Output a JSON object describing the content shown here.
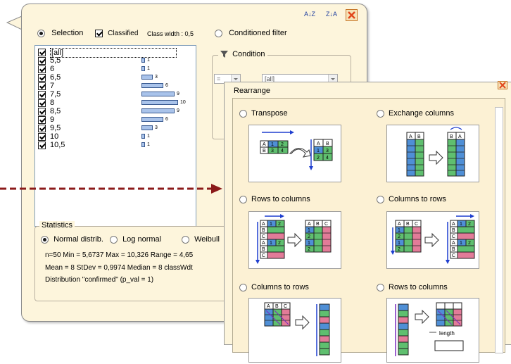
{
  "filter_panel": {
    "sort_asc_label": "A↓Z",
    "sort_desc_label": "Z↓A",
    "selection_label": "Selection",
    "classified_label": "Classified",
    "class_width_label": "Class width : 0,5",
    "conditioned_filter_label": "Conditioned filter",
    "condition_label": "Condition",
    "operator_value": "=",
    "condition_value": "[all]",
    "list_items": [
      {
        "label": "[all]",
        "count": null,
        "fraction": 0
      },
      {
        "label": "5,5",
        "count": "1",
        "fraction": 0.1
      },
      {
        "label": "6",
        "count": "1",
        "fraction": 0.1
      },
      {
        "label": "6,5",
        "count": "3",
        "fraction": 0.3
      },
      {
        "label": "7",
        "count": "6",
        "fraction": 0.6
      },
      {
        "label": "7,5",
        "count": "9",
        "fraction": 0.9
      },
      {
        "label": "8",
        "count": "10",
        "fraction": 1.0
      },
      {
        "label": "8,5",
        "count": "9",
        "fraction": 0.9
      },
      {
        "label": "9",
        "count": "6",
        "fraction": 0.6
      },
      {
        "label": "9,5",
        "count": "3",
        "fraction": 0.3
      },
      {
        "label": "10",
        "count": "1",
        "fraction": 0.1
      },
      {
        "label": "10,5",
        "count": "1",
        "fraction": 0.1
      }
    ],
    "statistics": {
      "title": "Statistics",
      "normal_label": "Normal distrib.",
      "lognormal_label": "Log normal",
      "weibull_label": "Weibull",
      "line1": "n=50   Min = 5,6737   Max = 10,326   Range = 4,65",
      "line2": "Mean = 8   StDev = 0,9974   Median = 8   classWdt",
      "line3": "Distribution \"confirmed\" (p_val = 1)"
    }
  },
  "rearrange": {
    "title": "Rearrange",
    "options": [
      {
        "label": "Transpose"
      },
      {
        "label": "Exchange columns"
      },
      {
        "label": "Rows to columns"
      },
      {
        "label": "Columns to rows"
      },
      {
        "label": "Columns to rows"
      },
      {
        "label": "Rows to columns"
      }
    ],
    "length_label": "length"
  },
  "colors": {
    "panel_bg": "#fdf5dc",
    "bar_fill": "#a9c3ea",
    "arrow_color": "#8b1a1a",
    "cell_green": "#5fbf6f",
    "cell_blue": "#4f8fd6",
    "cell_pink": "#e27b98"
  }
}
